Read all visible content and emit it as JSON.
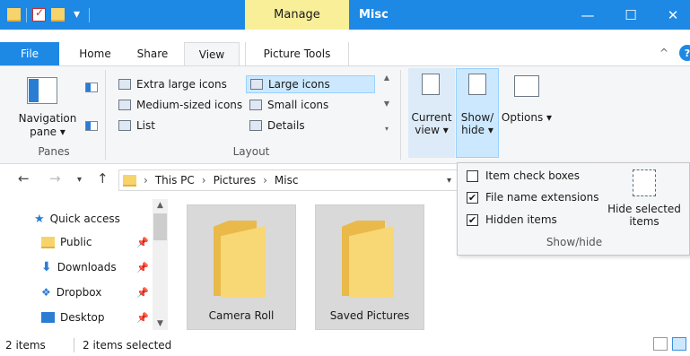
{
  "window": {
    "title": "Misc",
    "context_tab": "Manage",
    "controls": [
      "—",
      "☐",
      "✕"
    ]
  },
  "tabs": {
    "file": "File",
    "home": "Home",
    "share": "Share",
    "view": "View",
    "picture_tools": "Picture Tools"
  },
  "ribbon": {
    "panes": {
      "group": "Panes",
      "navigation_pane": "Navigation pane ▾"
    },
    "layout": {
      "group": "Layout",
      "options": [
        {
          "label": "Extra large icons",
          "selected": false
        },
        {
          "label": "Large icons",
          "selected": true
        },
        {
          "label": "Medium-sized icons",
          "selected": false
        },
        {
          "label": "Small icons",
          "selected": false
        },
        {
          "label": "List",
          "selected": false
        },
        {
          "label": "Details",
          "selected": false
        }
      ]
    },
    "current_view": "Current view ▾",
    "show_hide": "Show/ hide ▾",
    "options": "Options ▾"
  },
  "show_hide_panel": {
    "item_check_boxes": {
      "label": "Item check boxes",
      "checked": false
    },
    "file_name_extensions": {
      "label": "File name extensions",
      "checked": true
    },
    "hidden_items": {
      "label": "Hidden items",
      "checked": true
    },
    "hide_selected_items": "Hide selected items",
    "group": "Show/hide"
  },
  "address": {
    "crumbs": [
      "This PC",
      "Pictures",
      "Misc"
    ],
    "separator": "›"
  },
  "nav_tree": [
    {
      "label": "Quick access",
      "icon": "star-icon",
      "pinned": false
    },
    {
      "label": "Public",
      "icon": "folder-icon",
      "pinned": true
    },
    {
      "label": "Downloads",
      "icon": "download-icon",
      "pinned": true
    },
    {
      "label": "Dropbox",
      "icon": "dropbox-icon",
      "pinned": true
    },
    {
      "label": "Desktop",
      "icon": "desktop-icon",
      "pinned": true
    }
  ],
  "content": {
    "items": [
      {
        "label": "Camera Roll"
      },
      {
        "label": "Saved Pictures"
      }
    ]
  },
  "status": {
    "count": "2 items",
    "selected": "2 items selected"
  },
  "colors": {
    "accent": "#1e88e5",
    "context_tab": "#f9ef99",
    "selection": "#cce8ff"
  }
}
